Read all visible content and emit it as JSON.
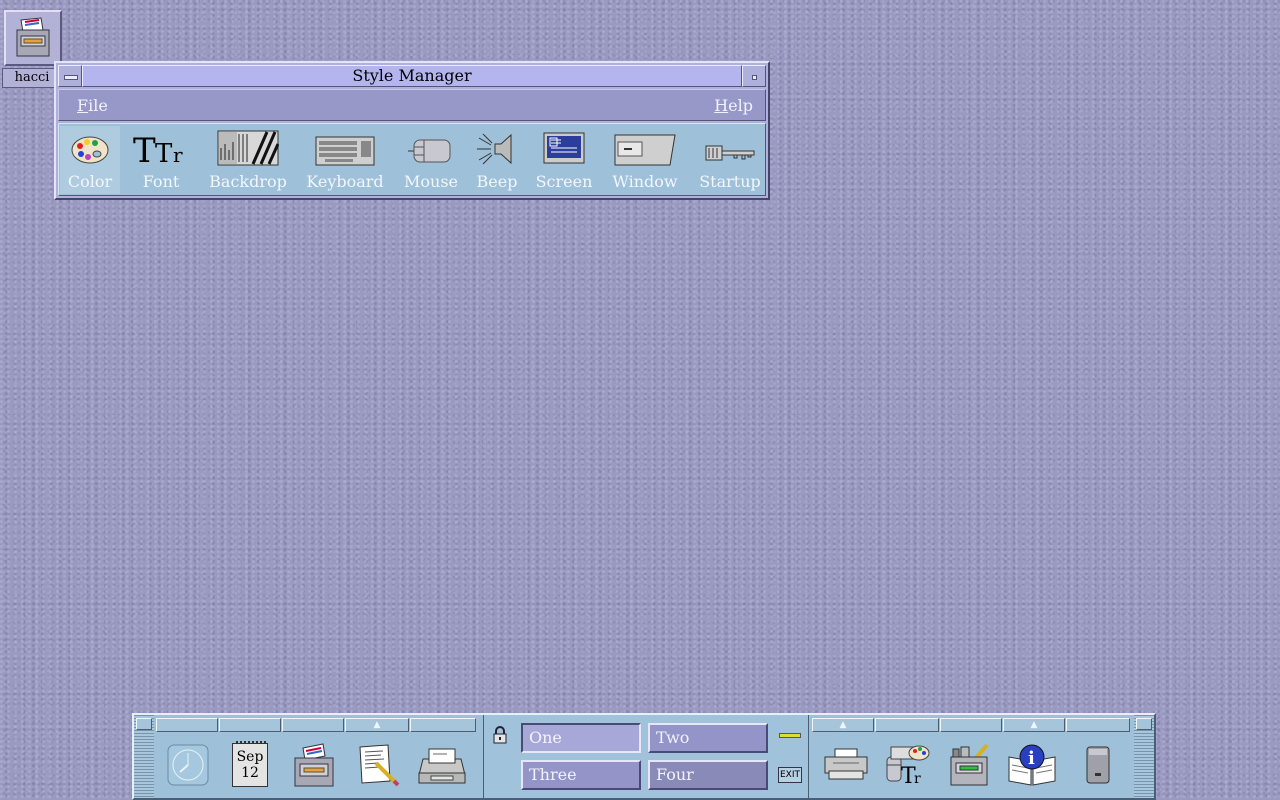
{
  "desktop": {
    "icon": {
      "label": "hacci",
      "icon": "file-cabinet-icon"
    }
  },
  "style_manager": {
    "title": "Style Manager",
    "menu": {
      "file": {
        "mnemonic": "F",
        "rest": "ile"
      },
      "help": {
        "mnemonic": "H",
        "rest": "elp"
      }
    },
    "tools": [
      {
        "label": "Color",
        "icon": "palette-icon",
        "active": true
      },
      {
        "label": "Font",
        "icon": "font-icon"
      },
      {
        "label": "Backdrop",
        "icon": "backdrop-icon"
      },
      {
        "label": "Keyboard",
        "icon": "keyboard-icon"
      },
      {
        "label": "Mouse",
        "icon": "mouse-icon"
      },
      {
        "label": "Beep",
        "icon": "speaker-icon"
      },
      {
        "label": "Screen",
        "icon": "monitor-icon"
      },
      {
        "label": "Window",
        "icon": "window-icon"
      },
      {
        "label": "Startup",
        "icon": "key-icon"
      }
    ]
  },
  "front_panel": {
    "calendar": {
      "month": "Sep",
      "day": "12"
    },
    "left_apps": [
      "clock-icon",
      "calendar-icon",
      "file-manager-icon",
      "text-editor-icon",
      "mailer-icon"
    ],
    "workspaces": [
      "One",
      "Two",
      "Three",
      "Four"
    ],
    "exit_label": "EXIT",
    "right_apps": [
      "printer-icon",
      "style-manager-icon",
      "application-manager-icon",
      "help-manager-icon",
      "trash-icon"
    ]
  },
  "colors": {
    "desktop_bg": "#9a9ac0",
    "window_title": "#b4b4ee",
    "menubar": "#9898c8",
    "toolbar": "#9ec0d8",
    "panel": "#9ec0d8"
  }
}
